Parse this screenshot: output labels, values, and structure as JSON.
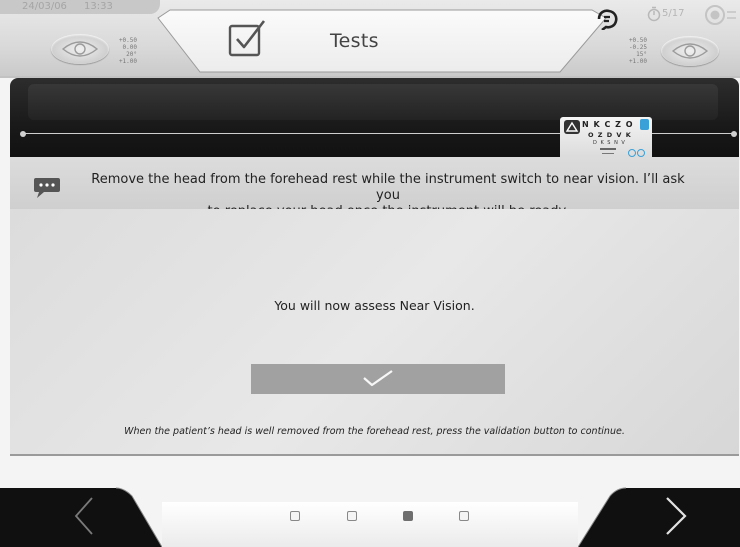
{
  "header": {
    "date": "24/03/06",
    "time": "13:33",
    "title": "Tests",
    "page_indicator": "5/17",
    "left_eye": {
      "sphere": "+0.50",
      "cylinder": "0.00",
      "axis": "20°",
      "addition": "+1.00"
    },
    "right_eye": {
      "sphere": "+0.50",
      "cylinder": "-0.25",
      "axis": "15°",
      "addition": "+1.00"
    }
  },
  "chart_card": {
    "row1": "N K C Z O",
    "row2": "O Z D V K",
    "row3": "D K S N V"
  },
  "message": {
    "line1": "Remove the head from the forehead rest while the instrument switch to near vision. I’ll ask you",
    "line2": "to replace your head once the instrument will be ready."
  },
  "main": {
    "assess_text": "You will now assess Near Vision.",
    "hint": "When the patient’s head is well removed from the forehead rest, press the validation button to continue."
  },
  "pagination": {
    "total": 4,
    "active_index": 2
  },
  "colors": {
    "validate_button": "#a1a1a1",
    "chart_accent": "#3aa0d8"
  },
  "icons": [
    "checkbox-icon",
    "eye-icon",
    "timer-icon",
    "target-icon",
    "speech-bubble-icon",
    "checkmark-icon",
    "chevron-left-icon",
    "chevron-right-icon"
  ]
}
